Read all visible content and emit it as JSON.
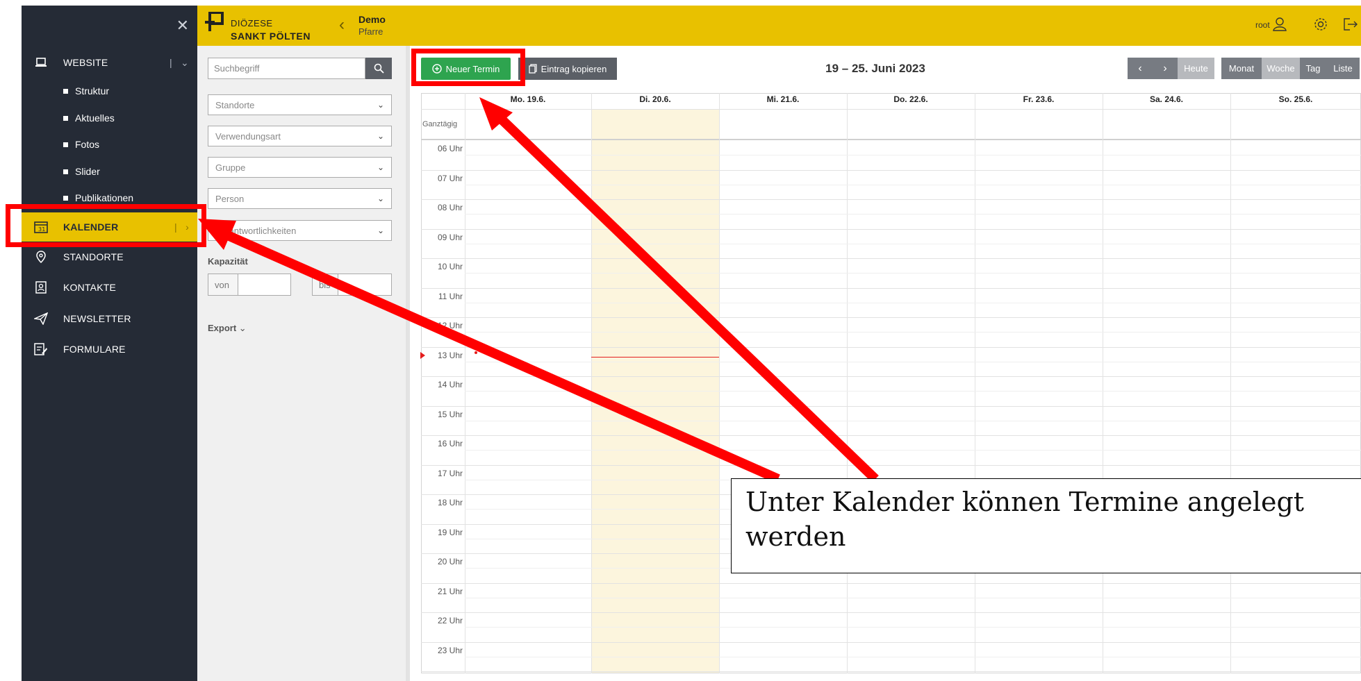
{
  "sidebar": {
    "items": [
      {
        "label": "WEBSITE",
        "icon": "laptop-icon"
      },
      {
        "label": "KALENDER",
        "icon": "calendar-icon"
      },
      {
        "label": "STANDORTE",
        "icon": "location-pin-icon"
      },
      {
        "label": "KONTAKTE",
        "icon": "contact-book-icon"
      },
      {
        "label": "NEWSLETTER",
        "icon": "paper-plane-icon"
      },
      {
        "label": "FORMULARE",
        "icon": "form-edit-icon"
      }
    ],
    "subitems": [
      "Struktur",
      "Aktuelles",
      "Fotos",
      "Slider",
      "Publikationen"
    ]
  },
  "header": {
    "logo_line1": "DIÖZESE",
    "logo_line2": "SANKT PÖLTEN",
    "context_title": "Demo",
    "context_sub": "Pfarre",
    "user": "root",
    "accent": "#e8c100"
  },
  "filters": {
    "search_placeholder": "Suchbegriff",
    "dropdowns": [
      "Standorte",
      "Verwendungsart",
      "Gruppe",
      "Person",
      "Verantwortlichkeiten"
    ],
    "capacity_label": "Kapazität",
    "from_label": "von",
    "to_label": "bis",
    "export_label": "Export"
  },
  "toolbar": {
    "new_label": "Neuer Termin",
    "copy_label": "Eintrag kopieren",
    "range_title": "19 – 25. Juni 2023",
    "today_label": "Heute",
    "views": [
      "Monat",
      "Woche",
      "Tag",
      "Liste"
    ],
    "active_view": "Woche"
  },
  "calendar": {
    "days": [
      "Mo. 19.6.",
      "Di. 20.6.",
      "Mi. 21.6.",
      "Do. 22.6.",
      "Fr. 23.6.",
      "Sa. 24.6.",
      "So. 25.6."
    ],
    "allday_label": "Ganztägig",
    "hours": [
      "06 Uhr",
      "07 Uhr",
      "08 Uhr",
      "09 Uhr",
      "10 Uhr",
      "11 Uhr",
      "12 Uhr",
      "13 Uhr",
      "14 Uhr",
      "15 Uhr",
      "16 Uhr",
      "17 Uhr",
      "18 Uhr",
      "19 Uhr",
      "20 Uhr",
      "21 Uhr",
      "22 Uhr",
      "23 Uhr"
    ]
  },
  "annotation": {
    "text_line1": "Unter Kalender können Termine angelegt",
    "text_line2": "werden"
  }
}
